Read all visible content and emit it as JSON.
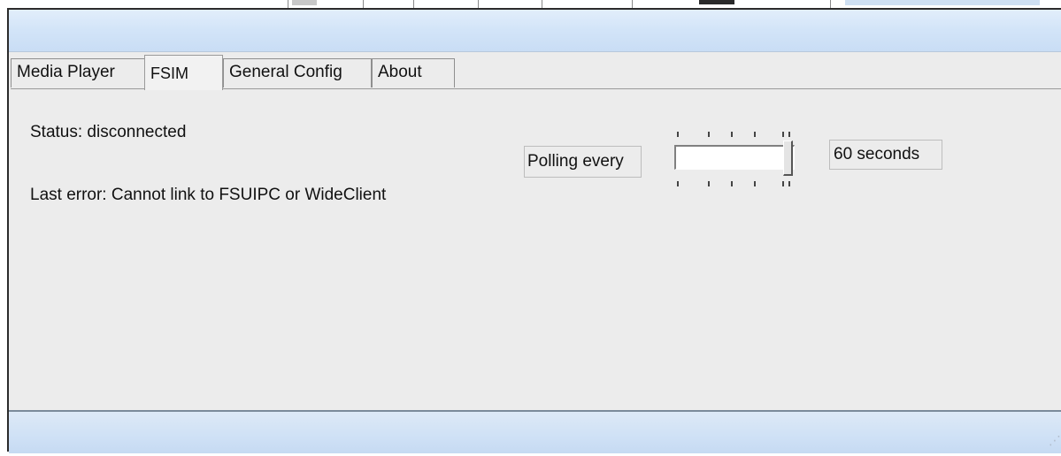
{
  "tabs": {
    "media_player": "Media Player",
    "fsim": "FSIM",
    "general_config": "General Config",
    "about": "About",
    "active": "FSIM"
  },
  "fsim": {
    "status": "Status: disconnected",
    "last_error": "Last error: Cannot link to FSUIPC or WideClient",
    "polling_label": "Polling every",
    "polling_value_label": "60 seconds",
    "polling_slider_position_fraction": 1.0
  },
  "colors": {
    "titlebar": "#d2e4f8",
    "panel": "#ececec",
    "statusbar": "#cfe1f6"
  }
}
